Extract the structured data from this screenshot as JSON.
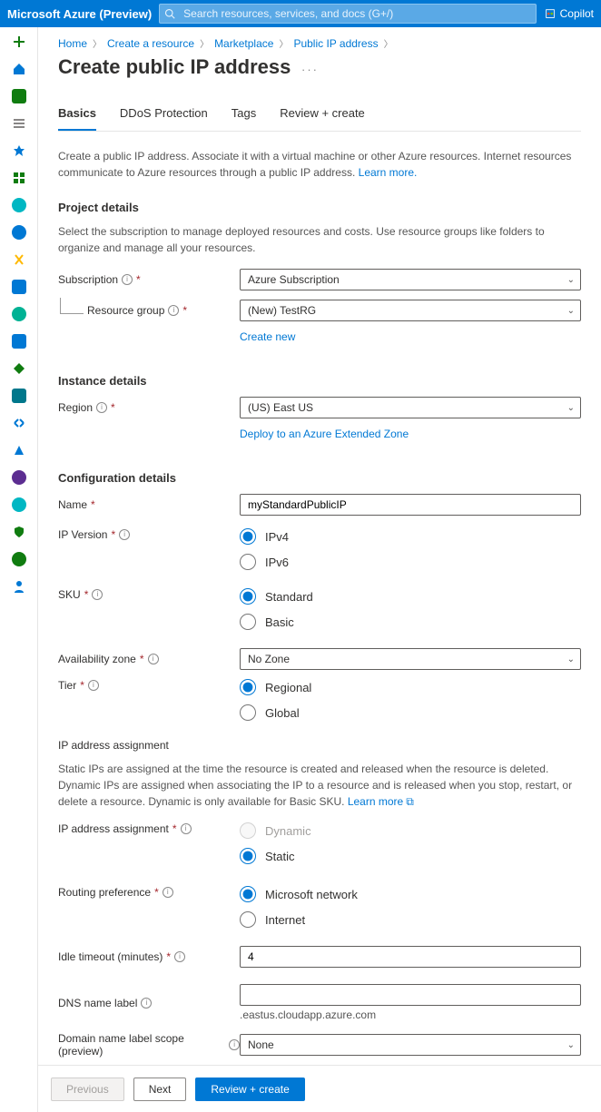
{
  "header": {
    "brand": "Microsoft Azure (Preview)",
    "search_placeholder": "Search resources, services, and docs (G+/)",
    "copilot": "Copilot"
  },
  "breadcrumb": {
    "items": [
      "Home",
      "Create a resource",
      "Marketplace",
      "Public IP address"
    ]
  },
  "page": {
    "title": "Create public IP address"
  },
  "tabs": {
    "items": [
      "Basics",
      "DDoS Protection",
      "Tags",
      "Review + create"
    ],
    "active": 0
  },
  "intro": {
    "text": "Create a public IP address. Associate it with a virtual machine or other Azure resources. Internet resources communicate to Azure resources through a public IP address.",
    "learn_more": "Learn more."
  },
  "project": {
    "heading": "Project details",
    "desc": "Select the subscription to manage deployed resources and costs. Use resource groups like folders to organize and manage all your resources.",
    "subscription_label": "Subscription",
    "subscription_value": "Azure Subscription",
    "rg_label": "Resource group",
    "rg_value": "(New) TestRG",
    "rg_create": "Create new"
  },
  "instance": {
    "heading": "Instance details",
    "region_label": "Region",
    "region_value": "(US) East US",
    "deploy_link": "Deploy to an Azure Extended Zone"
  },
  "config": {
    "heading": "Configuration details",
    "name_label": "Name",
    "name_value": "myStandardPublicIP",
    "ipversion_label": "IP Version",
    "ipv4": "IPv4",
    "ipv6": "IPv6",
    "sku_label": "SKU",
    "sku_standard": "Standard",
    "sku_basic": "Basic",
    "az_label": "Availability zone",
    "az_value": "No Zone",
    "tier_label": "Tier",
    "tier_regional": "Regional",
    "tier_global": "Global",
    "assign_heading": "IP address assignment",
    "assign_desc": "Static IPs are assigned at the time the resource is created and released when the resource is deleted. Dynamic IPs are assigned when associating the IP to a resource and is released when you stop, restart, or delete a resource. Dynamic is only available for Basic SKU.",
    "learn_more": "Learn more",
    "assign_label": "IP address assignment",
    "assign_dynamic": "Dynamic",
    "assign_static": "Static",
    "routing_label": "Routing preference",
    "routing_ms": "Microsoft network",
    "routing_internet": "Internet",
    "idle_label": "Idle timeout (minutes)",
    "idle_value": "4",
    "dns_label": "DNS name label",
    "dns_value": "",
    "dns_suffix": ".eastus.cloudapp.azure.com",
    "domain_label": "Domain name label scope (preview)",
    "domain_value": "None"
  },
  "footer": {
    "previous": "Previous",
    "next": "Next",
    "review": "Review + create"
  },
  "sidebar_colors": [
    "#107c10",
    "#0078d4",
    "#107c10",
    "#605e5c",
    "#0078d4",
    "#107c10",
    "#00b7c3",
    "#0078d4",
    "#ffb900",
    "#0078d4",
    "#00b294",
    "#0078d4",
    "#107c10",
    "#00778b",
    "#0078d4",
    "#0078d4",
    "#5c2d91",
    "#00b7c3",
    "#107c10",
    "#107c10",
    "#0078d4"
  ]
}
